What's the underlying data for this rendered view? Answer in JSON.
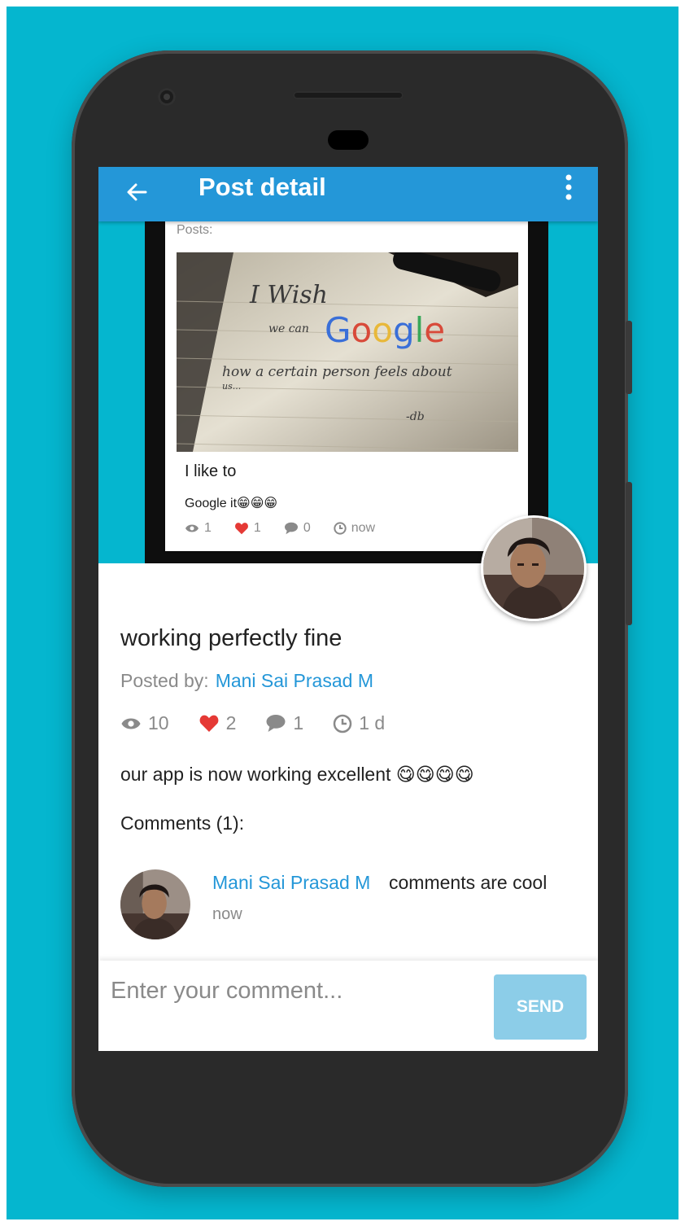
{
  "appbar": {
    "title": "Post detail"
  },
  "preview_card": {
    "posts_label": "Posts:",
    "image_text": {
      "line1": "I Wish",
      "line2a": "we can",
      "line2b": "Google",
      "line3": "how a certain person feels about",
      "line3b": "us...",
      "line4": "-db"
    },
    "title": "I like to",
    "body": "Google it😁😁😁",
    "stats": {
      "views": "1",
      "likes": "1",
      "comments": "0",
      "time": "now"
    }
  },
  "post": {
    "title": "working perfectly fine",
    "posted_by_label": "Posted by:",
    "author": "Mani Sai Prasad M",
    "stats": {
      "views": "10",
      "likes": "2",
      "comments": "1",
      "time": "1 d"
    },
    "body": "our app is now working excellent",
    "body_emojis": "😋😋😋😋"
  },
  "comments": {
    "heading": "Comments (1):",
    "items": [
      {
        "author": "Mani Sai Prasad M",
        "text": "comments are cool",
        "time": "now"
      }
    ]
  },
  "composer": {
    "placeholder": "Enter your comment...",
    "send_label": "SEND"
  },
  "colors": {
    "background": "#05b6cf",
    "appbar": "#2497d8",
    "link": "#2497d8",
    "like": "#e53935",
    "send_button": "#8ccde8"
  }
}
